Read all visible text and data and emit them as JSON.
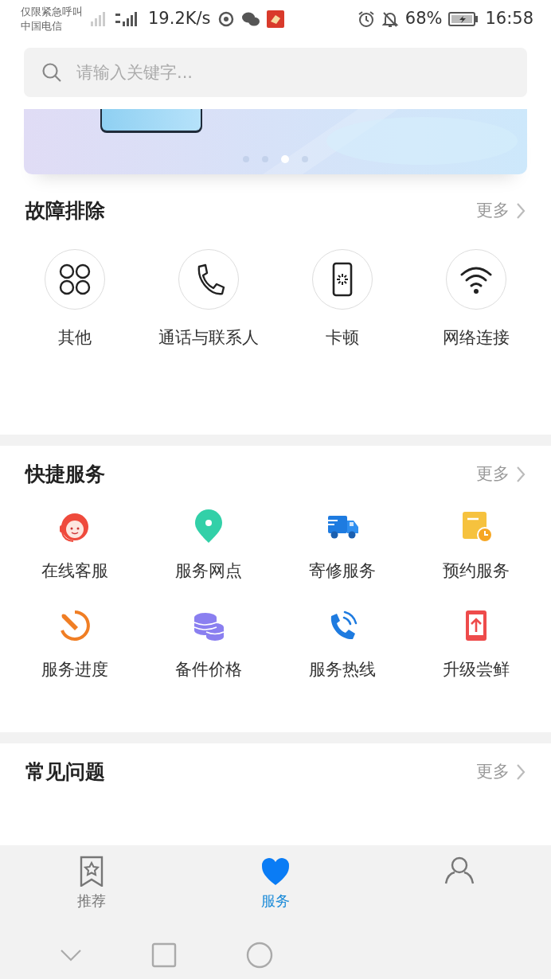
{
  "status_bar": {
    "carrier_lines": [
      "仅限紧急呼叫",
      "中国电信"
    ],
    "speed": "19.2K/s",
    "battery": "68%",
    "time": "16:58"
  },
  "search": {
    "placeholder": "请输入关键字..."
  },
  "banner": {
    "dots": [
      {
        "selected": false
      },
      {
        "selected": false
      },
      {
        "selected": true
      },
      {
        "selected": false
      }
    ]
  },
  "troubleshooting": {
    "title": "故障排除",
    "more": "更多",
    "items": [
      {
        "label": "其他"
      },
      {
        "label": "通话与联系人"
      },
      {
        "label": "卡顿"
      },
      {
        "label": "网络连接"
      }
    ]
  },
  "quick_services": {
    "title": "快捷服务",
    "more": "更多",
    "items": [
      {
        "label": "在线客服"
      },
      {
        "label": "服务网点"
      },
      {
        "label": "寄修服务"
      },
      {
        "label": "预约服务"
      },
      {
        "label": "服务进度"
      },
      {
        "label": "备件价格"
      },
      {
        "label": "服务热线"
      },
      {
        "label": "升级尝鲜"
      }
    ]
  },
  "faq": {
    "title": "常见问题",
    "more": "更多"
  },
  "tabs": [
    {
      "label": "推荐",
      "selected": false
    },
    {
      "label": "服务",
      "selected": true
    },
    {
      "selected": false
    }
  ]
}
